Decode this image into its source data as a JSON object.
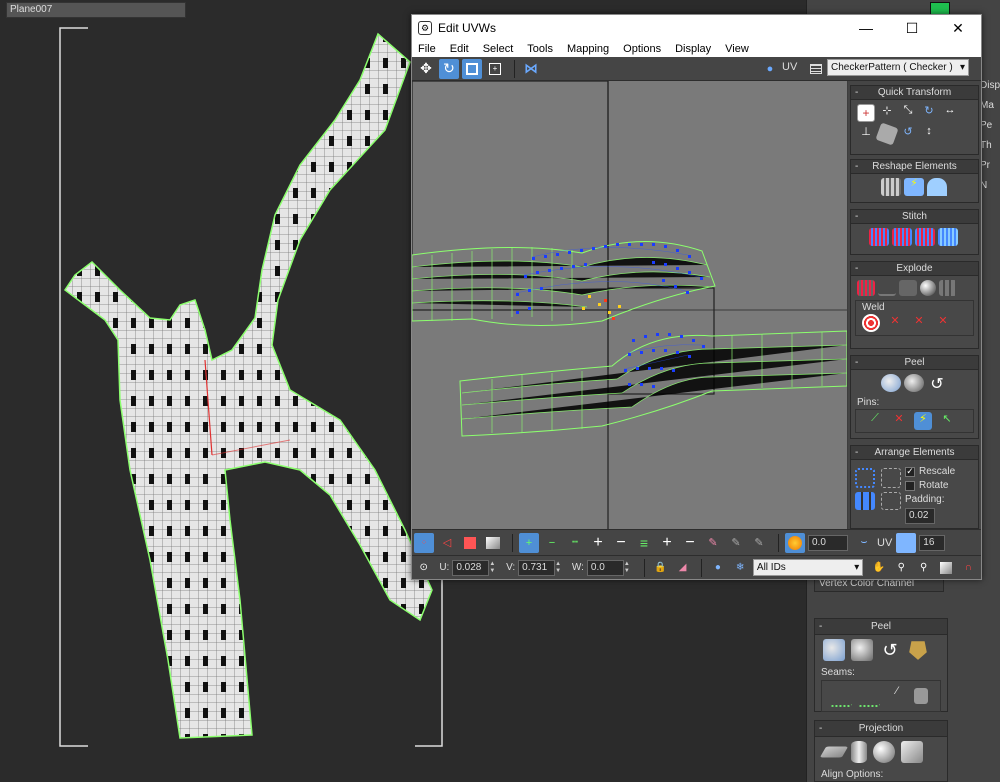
{
  "command_panel": {
    "object_name": "Plane007",
    "side_checks": [
      "Displ",
      "Ma",
      "Pe",
      "Th",
      "Pr",
      "N"
    ],
    "vertex_color_label": "Vertex Color Channel",
    "peel": {
      "title": "Peel",
      "seams_label": "Seams:"
    },
    "projection": {
      "title": "Projection",
      "align_label": "Align Options:"
    }
  },
  "uvw_window": {
    "title": "Edit UVWs",
    "window_buttons": {
      "minimize": "—",
      "maximize": "☐",
      "close": "✕"
    },
    "menu": [
      "File",
      "Edit",
      "Select",
      "Tools",
      "Mapping",
      "Options",
      "Display",
      "View"
    ],
    "uv_label": "UV",
    "checker_value": "CheckerPattern  ( Checker )",
    "side": {
      "quick_transform": "Quick Transform",
      "reshape_elements": "Reshape Elements",
      "stitch": "Stitch",
      "explode": "Explode",
      "weld": "Weld",
      "peel": "Peel",
      "pins": "Pins:",
      "arrange_elements": "Arrange Elements",
      "rescale": "Rescale",
      "rotate": "Rotate",
      "padding": "Padding:",
      "padding_value": "0.02"
    },
    "bottom": {
      "soft_value": "0.0",
      "uv_label": "UV",
      "grid_value": "16",
      "u_label": "U:",
      "u_value": "0.028",
      "v_label": "V:",
      "v_value": "0.731",
      "w_label": "W:",
      "w_value": "0.0",
      "ids_value": "All IDs"
    }
  },
  "colors": {
    "selection_blue": "#4f8fd6",
    "wire_green": "#8cff6e",
    "vertex_blue": "#1a3cff",
    "object_swatch": "#1fbf4f"
  }
}
